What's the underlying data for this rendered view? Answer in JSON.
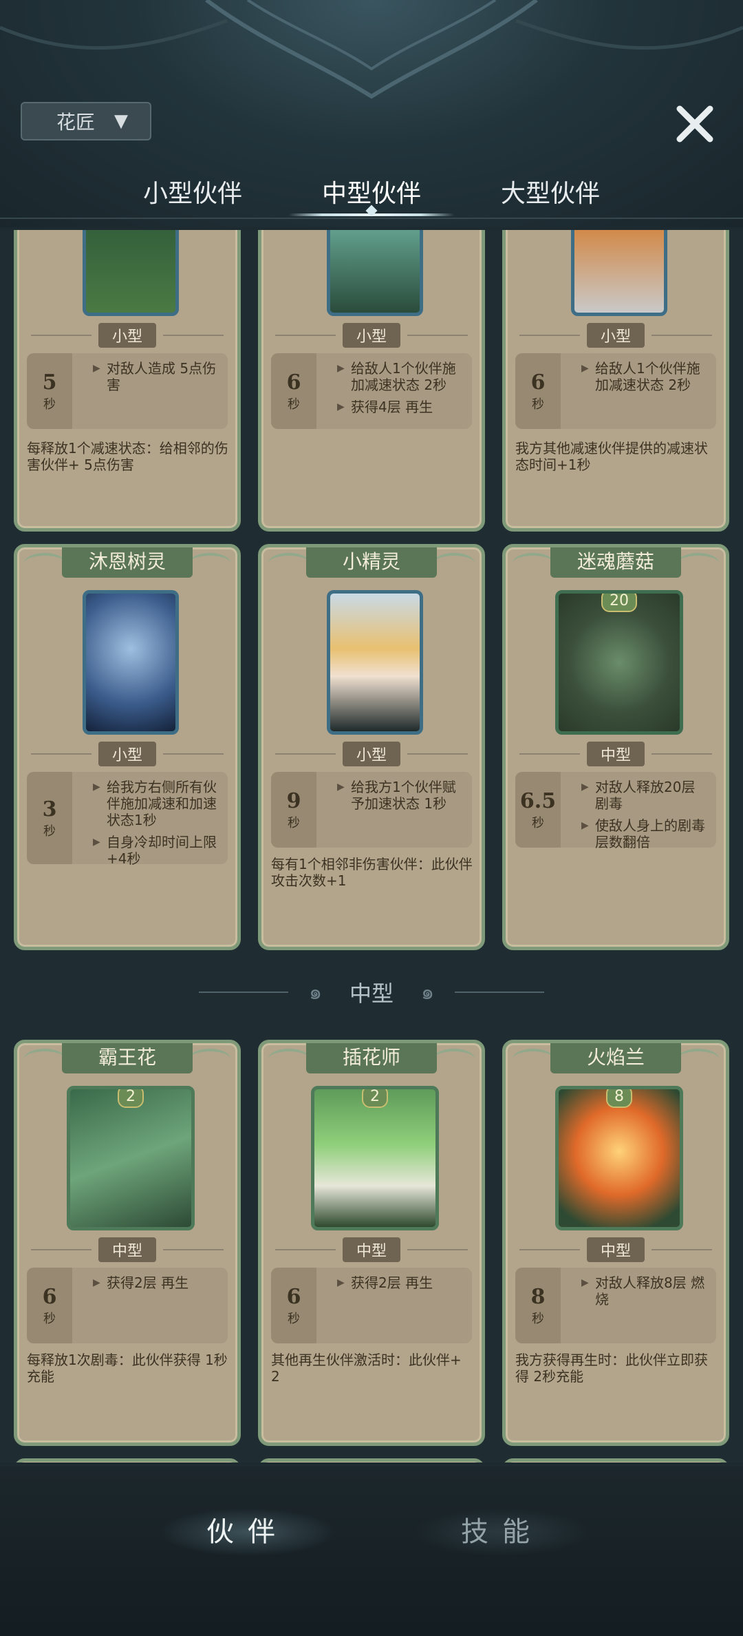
{
  "filter": {
    "label": "花匠"
  },
  "tabs": [
    {
      "label": "小型伙伴"
    },
    {
      "label": "中型伙伴"
    },
    {
      "label": "大型伙伴"
    }
  ],
  "row1": [
    {
      "size": "小型",
      "cd": "5",
      "cd_unit": "秒",
      "skills": [
        "对敌人造成 5点伤害"
      ],
      "desc": "每释放1个减速状态：给相邻的伤害伙伴+ 5点伤害"
    },
    {
      "size": "小型",
      "cd": "6",
      "cd_unit": "秒",
      "skills": [
        "给敌人1个伙伴施加减速状态 2秒",
        "获得4层 再生"
      ],
      "desc": ""
    },
    {
      "size": "小型",
      "cd": "6",
      "cd_unit": "秒",
      "skills": [
        "给敌人1个伙伴施加减速状态 2秒"
      ],
      "desc": "我方其他减速伙伴提供的减速状态时间+1秒"
    }
  ],
  "row2": [
    {
      "name": "沐恩树灵",
      "size": "小型",
      "cd": "3",
      "cd_unit": "秒",
      "skills": [
        "给我方右侧所有伙伴施加减速和加速状态1秒",
        "自身冷却时间上限+4秒"
      ],
      "desc": ""
    },
    {
      "name": "小精灵",
      "size": "小型",
      "cd": "9",
      "cd_unit": "秒",
      "skills": [
        "给我方1个伙伴赋予加速状态 1秒"
      ],
      "desc": "每有1个相邻非伤害伙伴：此伙伴攻击次数+1"
    },
    {
      "name": "迷魂蘑菇",
      "cost": "20",
      "size": "中型",
      "cd": "6.5",
      "cd_unit": "秒",
      "skills": [
        "对敌人释放20层 剧毒",
        "使敌人身上的剧毒层数翻倍"
      ],
      "desc": ""
    }
  ],
  "section": {
    "label": "中型"
  },
  "row3": [
    {
      "name": "霸王花",
      "cost": "2",
      "size": "中型",
      "cd": "6",
      "cd_unit": "秒",
      "skills": [
        "获得2层 再生"
      ],
      "desc": "每释放1次剧毒：此伙伴获得 1秒充能"
    },
    {
      "name": "插花师",
      "cost": "2",
      "size": "中型",
      "cd": "6",
      "cd_unit": "秒",
      "skills": [
        "获得2层 再生"
      ],
      "desc": "其他再生伙伴激活时：此伙伴+ 2"
    },
    {
      "name": "火焰兰",
      "cost": "8",
      "size": "中型",
      "cd": "8",
      "cd_unit": "秒",
      "skills": [
        "对敌人释放8层 燃烧"
      ],
      "desc": "我方获得再生时：此伙伴立即获得 2秒充能"
    }
  ],
  "bottom_nav": [
    {
      "label": "伙伴"
    },
    {
      "label": "技能"
    }
  ],
  "colors": {
    "card_bg": "#b3a58c",
    "card_border": "#7f9a78",
    "nameplate": "#5b7657"
  },
  "icons": [
    "filter-funnel-icon",
    "close-icon",
    "damage-burst-icon",
    "slow-icon",
    "regen-cross-icon",
    "haste-icon",
    "poison-skull-icon",
    "charge-bolt-icon",
    "burn-flame-icon"
  ]
}
